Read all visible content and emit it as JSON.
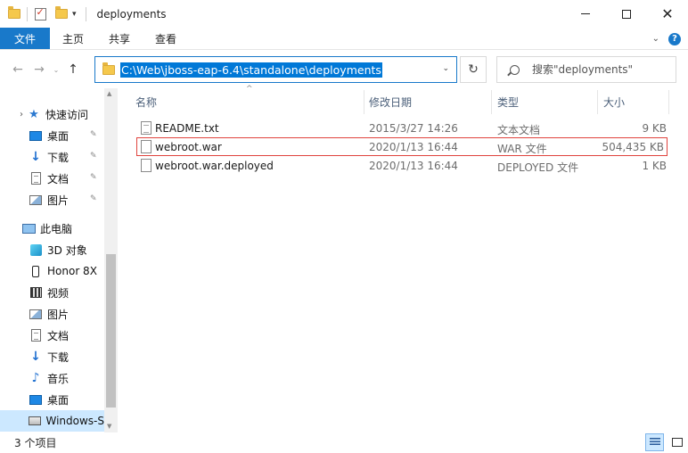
{
  "window": {
    "title": "deployments",
    "minimize_glyph": "—",
    "maximize_glyph": "☐",
    "close_glyph": "✕"
  },
  "quick_access_toolbar": {
    "icons": [
      "folder-icon",
      "properties-icon",
      "new-folder-icon"
    ],
    "dropdown_glyph": "▾"
  },
  "ribbon": {
    "tabs": [
      {
        "label": "文件",
        "active": true
      },
      {
        "label": "主页"
      },
      {
        "label": "共享"
      },
      {
        "label": "查看"
      }
    ],
    "expand_glyph": "⌄",
    "help_glyph": "?"
  },
  "navigation": {
    "back_glyph": "←",
    "forward_glyph": "→",
    "recent_glyph": "⌄",
    "up_glyph": "↑"
  },
  "address_bar": {
    "path": "C:\\Web\\jboss-eap-6.4\\standalone\\deployments",
    "dropdown_glyph": "⌄"
  },
  "refresh_glyph": "↻",
  "search": {
    "placeholder": "搜索\"deployments\""
  },
  "sidebar": {
    "quick_access": {
      "label": "快速访问",
      "icon": "star-icon"
    },
    "pinned": [
      {
        "label": "桌面",
        "icon": "desktop-icon"
      },
      {
        "label": "下载",
        "icon": "download-icon"
      },
      {
        "label": "文档",
        "icon": "document-icon"
      },
      {
        "label": "图片",
        "icon": "pictures-icon"
      }
    ],
    "this_pc": {
      "label": "此电脑",
      "icon": "computer-icon"
    },
    "pc_items": [
      {
        "label": "3D 对象",
        "icon": "3d-objects-icon"
      },
      {
        "label": "Honor 8X",
        "icon": "phone-icon"
      },
      {
        "label": "视频",
        "icon": "video-icon"
      },
      {
        "label": "图片",
        "icon": "pictures-icon"
      },
      {
        "label": "文档",
        "icon": "document-icon"
      },
      {
        "label": "下载",
        "icon": "download-icon"
      },
      {
        "label": "音乐",
        "icon": "music-icon"
      },
      {
        "label": "桌面",
        "icon": "desktop-icon"
      },
      {
        "label": "Windows-S",
        "icon": "drive-icon",
        "selected": true
      }
    ],
    "pin_glyph": "📌",
    "chevron_glyph": "›"
  },
  "columns": [
    {
      "label": "名称"
    },
    {
      "label": "修改日期"
    },
    {
      "label": "类型"
    },
    {
      "label": "大小"
    }
  ],
  "sort_indicator": "^",
  "files": [
    {
      "name": "README.txt",
      "modified": "2015/3/27 14:26",
      "type": "文本文档",
      "size": "9 KB",
      "icon": "text-file-icon",
      "highlighted": false
    },
    {
      "name": "webroot.war",
      "modified": "2020/1/13 16:44",
      "type": "WAR 文件",
      "size": "504,435 KB",
      "icon": "file-icon",
      "highlighted": true
    },
    {
      "name": "webroot.war.deployed",
      "modified": "2020/1/13 16:44",
      "type": "DEPLOYED 文件",
      "size": "1 KB",
      "icon": "file-icon",
      "highlighted": false
    }
  ],
  "status_bar": {
    "item_count": "3 个项目"
  },
  "colors": {
    "accent": "#1979ca",
    "selection": "#cce8ff",
    "highlight_border": "#e0443e"
  }
}
